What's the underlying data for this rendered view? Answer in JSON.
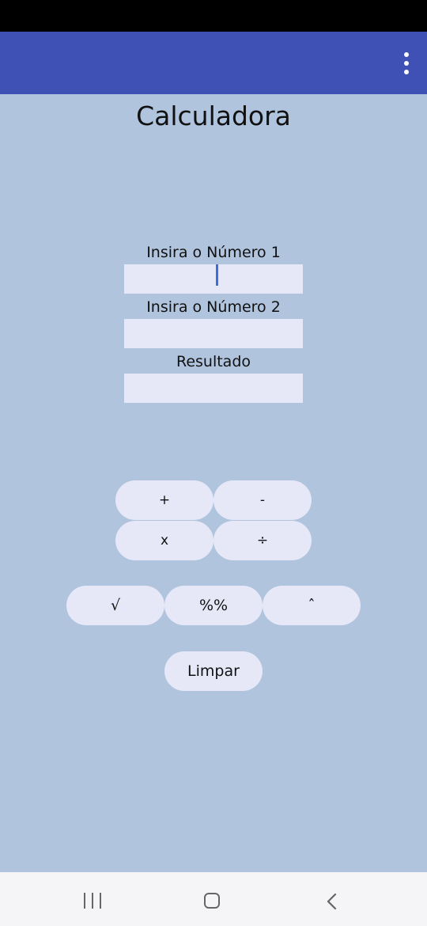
{
  "app_bar": {
    "background": "#3f51b5",
    "menu_icon": "overflow-menu-icon"
  },
  "page": {
    "title": "Calculadora",
    "background": "#b0c4de"
  },
  "fields": {
    "number1": {
      "label": "Insira o Número 1",
      "value": ""
    },
    "number2": {
      "label": "Insira o Número 2",
      "value": ""
    },
    "result": {
      "label": "Resultado",
      "value": ""
    }
  },
  "buttons": {
    "add": "+",
    "subtract": "-",
    "multiply": "x",
    "divide": "÷",
    "sqrt": "√",
    "percent": "%%",
    "power": "ˆ",
    "clear": "Limpar"
  },
  "nav_bar": {
    "recents_icon": "recents-icon",
    "home_icon": "home-icon",
    "back_icon": "back-icon"
  }
}
